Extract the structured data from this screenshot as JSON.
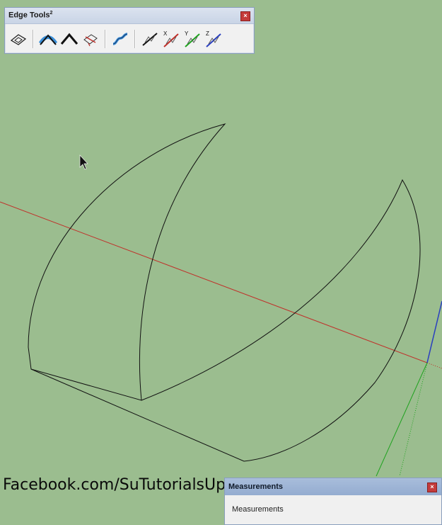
{
  "toolbar": {
    "title": "Edge Tools",
    "title_superscript": "2",
    "tools": [
      {
        "name": "simplify-contours-icon"
      },
      {
        "name": "smooth-soft-icon"
      },
      {
        "name": "smooth-hard-icon"
      },
      {
        "name": "divide-face-icon"
      },
      {
        "name": "curve-smooth-icon"
      },
      {
        "name": "edge-to-line-icon"
      },
      {
        "name": "edge-x-icon",
        "label": "X"
      },
      {
        "name": "edge-y-icon",
        "label": "Y"
      },
      {
        "name": "edge-z-icon",
        "label": "Z"
      }
    ]
  },
  "watermark": "Facebook.com/SuTutorialsUp",
  "measurements": {
    "title": "Measurements",
    "label": "Measurements"
  },
  "colors": {
    "background": "#9bbd8f",
    "axis_red": "#c0302a",
    "axis_green": "#1fa21f",
    "axis_blue": "#2a3fbf",
    "close_button": "#c43b3b",
    "panel_titlebar": "#a8bddb"
  }
}
